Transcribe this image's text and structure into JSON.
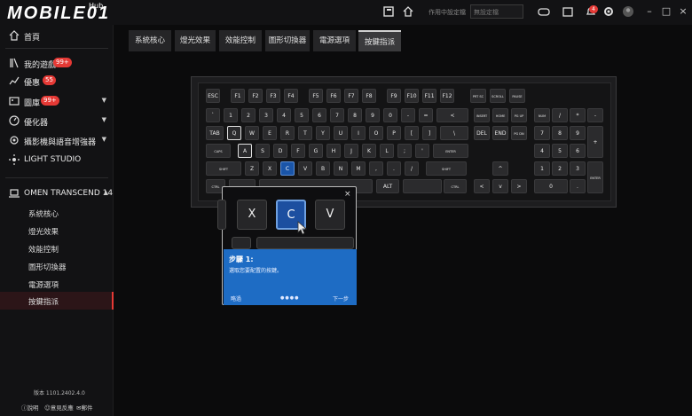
{
  "header": {
    "logo_text": "MOBILE01",
    "logo_hub": "Hub",
    "profile_label": "作用中設定檔",
    "profile_placeholder": "無設定檔",
    "notif_count": "4"
  },
  "sidebar": {
    "items": [
      {
        "label": "首頁"
      },
      {
        "label": "我的遊戲",
        "badge": "99+"
      },
      {
        "label": "優惠",
        "badge": "55"
      },
      {
        "label": "圖庫",
        "badge": "99+"
      },
      {
        "label": "優化器"
      },
      {
        "label": "攝影機與語音增強器"
      },
      {
        "label": "LIGHT STUDIO"
      }
    ],
    "device": "OMEN TRANSCEND 14",
    "sub_items": [
      "系統核心",
      "燈光效果",
      "效能控制",
      "圖形切換器",
      "電源選項",
      "按鍵指派"
    ],
    "version": "版本 1101.2402.4.0",
    "footer": [
      "說明",
      "意見反應",
      "郵件"
    ]
  },
  "tabs": [
    "系統核心",
    "燈光效果",
    "效能控制",
    "圖形切換器",
    "電源選項",
    "按鍵指派"
  ],
  "keyboard": {
    "row0": [
      "ESC",
      "F1",
      "F2",
      "F3",
      "F4",
      "F5",
      "F6",
      "F7",
      "F8",
      "F9",
      "F10",
      "F11",
      "F12",
      "PRT SC",
      "SCROLL LOCK",
      "PAUSE BREAK"
    ],
    "row1": [
      "`",
      "1",
      "2",
      "3",
      "4",
      "5",
      "6",
      "7",
      "8",
      "9",
      "0",
      "-",
      "=",
      "<",
      "INSERT",
      "HOME",
      "PG UP",
      "NUM LOCK",
      "/",
      "*",
      "-"
    ],
    "row2": [
      "TAB",
      "Q",
      "W",
      "E",
      "R",
      "T",
      "Y",
      "U",
      "I",
      "O",
      "P",
      "[",
      "]",
      "\\",
      "DEL",
      "END",
      "PG DN",
      "7",
      "8",
      "9",
      "+"
    ],
    "row3": [
      "CAPS",
      "A",
      "S",
      "D",
      "F",
      "G",
      "H",
      "J",
      "K",
      "L",
      ";",
      "'",
      "ENTER",
      "4",
      "5",
      "6"
    ],
    "row4": [
      "SHIFT",
      "Z",
      "X",
      "C",
      "V",
      "B",
      "N",
      "M",
      ",",
      ".",
      "/",
      "SHIFT",
      "^",
      "1",
      "2",
      "3",
      "ENTER"
    ],
    "row5": [
      "CTRL",
      "ALT",
      "CTRL",
      "<",
      "v",
      ">",
      "0",
      "."
    ]
  },
  "popup": {
    "keys": [
      "X",
      "C",
      "V"
    ],
    "title": "步驟 1:",
    "description": "選取您要配置的按鍵。",
    "skip": "略過",
    "next": "下一步",
    "close": "×",
    "dots": "●●●●"
  },
  "colors": {
    "accent": "#e53935",
    "selected_key": "#1a55a8",
    "popup_blue": "#1e6cc4"
  }
}
